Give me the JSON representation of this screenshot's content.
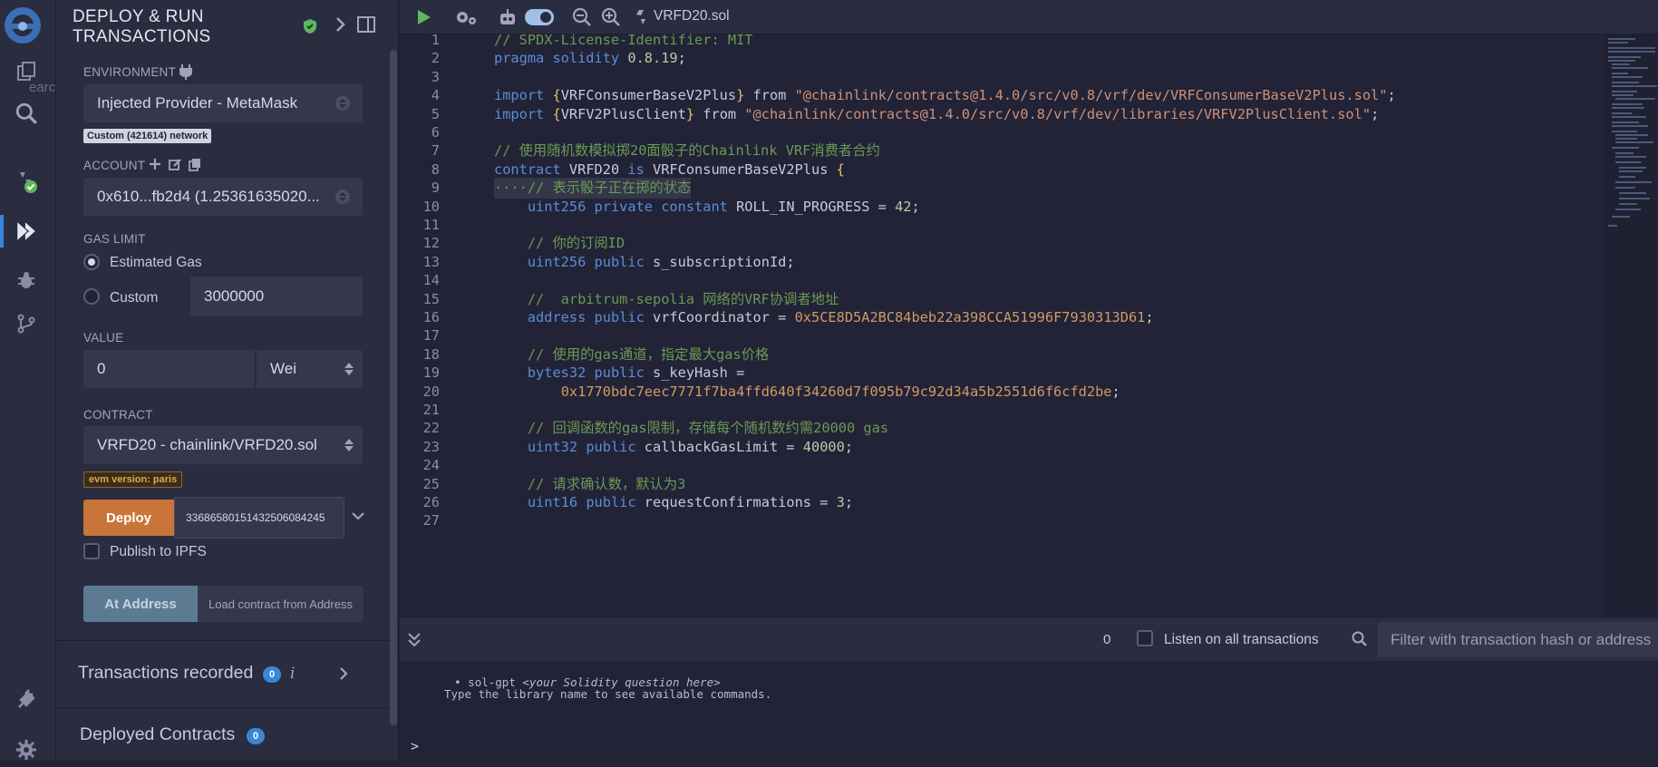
{
  "window": {
    "title": "Remix IDE"
  },
  "panel": {
    "title": "DEPLOY & RUN TRANSACTIONS",
    "environment": {
      "label": "ENVIRONMENT",
      "value": "Injected Provider - MetaMask",
      "network_badge": "Custom (421614) network"
    },
    "account": {
      "label": "ACCOUNT",
      "value": "0x610...fb2d4 (1.25361635020..."
    },
    "gas_limit": {
      "label": "GAS LIMIT",
      "estimated_label": "Estimated Gas",
      "custom_label": "Custom",
      "custom_value": "3000000",
      "selected": "estimated"
    },
    "value": {
      "label": "VALUE",
      "amount": "0",
      "unit": "Wei"
    },
    "contract": {
      "label": "CONTRACT",
      "value": "VRFD20 - chainlink/VRFD20.sol",
      "evm_badge": "evm version: paris"
    },
    "deploy": {
      "button_label": "Deploy",
      "input_value": "33686580151432506084245"
    },
    "publish_ipfs_label": "Publish to IPFS",
    "at_address": {
      "button_label": "At Address",
      "input_placeholder": "Load contract from Address"
    },
    "transactions_recorded": {
      "label": "Transactions recorded",
      "count": "0"
    },
    "deployed_contracts": {
      "label": "Deployed Contracts",
      "count": "0"
    },
    "ghost_search_text": "earch in files"
  },
  "toolbar": {
    "file_tab": "VRFD20.sol"
  },
  "editor": {
    "lines": [
      {
        "n": "1",
        "segs": [
          [
            "c-com",
            "// SPDX-License-Identifier: MIT"
          ]
        ]
      },
      {
        "n": "2",
        "segs": [
          [
            "c-kw",
            "pragma solidity"
          ],
          [
            "",
            " "
          ],
          [
            "c-num",
            "0.8.19"
          ],
          [
            "",
            ";"
          ]
        ]
      },
      {
        "n": "3",
        "segs": []
      },
      {
        "n": "4",
        "segs": [
          [
            "c-kw",
            "import"
          ],
          [
            "",
            " "
          ],
          [
            "c-br",
            "{"
          ],
          [
            "",
            "VRFConsumerBaseV2Plus"
          ],
          [
            "c-br",
            "}"
          ],
          [
            "",
            " from "
          ],
          [
            "c-str",
            "\"@chainlink/contracts@1.4.0/src/v0.8/vrf/dev/VRFConsumerBaseV2Plus.sol\""
          ],
          [
            "",
            ";"
          ]
        ]
      },
      {
        "n": "5",
        "segs": [
          [
            "c-kw",
            "import"
          ],
          [
            "",
            " "
          ],
          [
            "c-br",
            "{"
          ],
          [
            "",
            "VRFV2PlusClient"
          ],
          [
            "c-br",
            "}"
          ],
          [
            "",
            " from "
          ],
          [
            "c-str",
            "\"@chainlink/contracts@1.4.0/src/v0.8/vrf/dev/libraries/VRFV2PlusClient.sol\""
          ],
          [
            "",
            ";"
          ]
        ]
      },
      {
        "n": "6",
        "segs": []
      },
      {
        "n": "7",
        "segs": [
          [
            "c-com",
            "// 使用随机数模拟掷20面骰子的Chainlink VRF消费者合约"
          ]
        ]
      },
      {
        "n": "8",
        "segs": [
          [
            "c-kw",
            "contract"
          ],
          [
            "",
            " VRFD20 "
          ],
          [
            "c-kw",
            "is"
          ],
          [
            "",
            " VRFConsumerBaseV2Plus "
          ],
          [
            "c-br",
            "{"
          ]
        ]
      },
      {
        "n": "9",
        "segs": [
          [
            "c-com",
            "····// 表示骰子正在掷的状态"
          ]
        ]
      },
      {
        "n": "10",
        "segs": [
          [
            "",
            "    "
          ],
          [
            "c-kw",
            "uint256"
          ],
          [
            "",
            " "
          ],
          [
            "c-kw",
            "private constant"
          ],
          [
            "",
            " ROLL_IN_PROGRESS = "
          ],
          [
            "c-num",
            "42"
          ],
          [
            "",
            ";"
          ]
        ]
      },
      {
        "n": "11",
        "segs": []
      },
      {
        "n": "12",
        "segs": [
          [
            "",
            "    "
          ],
          [
            "c-com",
            "// 你的订阅ID"
          ]
        ]
      },
      {
        "n": "13",
        "segs": [
          [
            "",
            "    "
          ],
          [
            "c-kw",
            "uint256"
          ],
          [
            "",
            " "
          ],
          [
            "c-kw",
            "public"
          ],
          [
            "",
            " s_subscriptionId;"
          ]
        ]
      },
      {
        "n": "14",
        "segs": []
      },
      {
        "n": "15",
        "segs": [
          [
            "",
            "    "
          ],
          [
            "c-com",
            "//  arbitrum-sepolia 网络的VRF协调者地址"
          ]
        ]
      },
      {
        "n": "16",
        "segs": [
          [
            "",
            "    "
          ],
          [
            "c-kw",
            "address"
          ],
          [
            "",
            " "
          ],
          [
            "c-kw",
            "public"
          ],
          [
            "",
            " vrfCoordinator = "
          ],
          [
            "c-hex",
            "0x5CE8D5A2BC84beb22a398CCA51996F7930313D61"
          ],
          [
            "",
            ";"
          ]
        ]
      },
      {
        "n": "17",
        "segs": []
      },
      {
        "n": "18",
        "segs": [
          [
            "",
            "    "
          ],
          [
            "c-com",
            "// 使用的gas通道，指定最大gas价格"
          ]
        ]
      },
      {
        "n": "19",
        "segs": [
          [
            "",
            "    "
          ],
          [
            "c-kw",
            "bytes32"
          ],
          [
            "",
            " "
          ],
          [
            "c-kw",
            "public"
          ],
          [
            "",
            " s_keyHash ="
          ]
        ]
      },
      {
        "n": "20",
        "segs": [
          [
            "",
            "        "
          ],
          [
            "c-hex",
            "0x1770bdc7eec7771f7ba4ffd640f34260d7f095b79c92d34a5b2551d6f6cfd2be"
          ],
          [
            "",
            ";"
          ]
        ]
      },
      {
        "n": "21",
        "segs": []
      },
      {
        "n": "22",
        "segs": [
          [
            "",
            "    "
          ],
          [
            "c-com",
            "// 回调函数的gas限制，存储每个随机数约需20000 gas"
          ]
        ]
      },
      {
        "n": "23",
        "segs": [
          [
            "",
            "    "
          ],
          [
            "c-kw",
            "uint32"
          ],
          [
            "",
            " "
          ],
          [
            "c-kw",
            "public"
          ],
          [
            "",
            " callbackGasLimit = "
          ],
          [
            "c-num",
            "40000"
          ],
          [
            "",
            ";"
          ]
        ]
      },
      {
        "n": "24",
        "segs": []
      },
      {
        "n": "25",
        "segs": [
          [
            "",
            "    "
          ],
          [
            "c-com",
            "// 请求确认数，默认为3"
          ]
        ]
      },
      {
        "n": "26",
        "segs": [
          [
            "",
            "    "
          ],
          [
            "c-kw",
            "uint16"
          ],
          [
            "",
            " "
          ],
          [
            "c-kw",
            "public"
          ],
          [
            "",
            " requestConfirmations = "
          ],
          [
            "c-num",
            "3"
          ],
          [
            "",
            ";"
          ]
        ]
      },
      {
        "n": "27",
        "segs": []
      }
    ]
  },
  "terminal_bar": {
    "pending_count": "0",
    "listen_label": "Listen on all transactions",
    "filter_placeholder": "Filter with transaction hash or address"
  },
  "terminal": {
    "line1_cmd": "sol-gpt",
    "line1_hint": "<your Solidity question here>",
    "line2": "Type the library name to see available commands.",
    "prompt": ">"
  },
  "colors": {
    "accent": "#3a86d6",
    "deploy": "#c97539",
    "background": "#222336",
    "panel": "#2a2c3f"
  },
  "icons": {
    "rail": [
      "remix-logo-icon",
      "file-explorer-icon",
      "search-icon",
      "solidity-compiler-icon",
      "deploy-run-icon",
      "debugger-icon",
      "git-icon",
      "plugin-manager-icon",
      "settings-icon"
    ]
  }
}
